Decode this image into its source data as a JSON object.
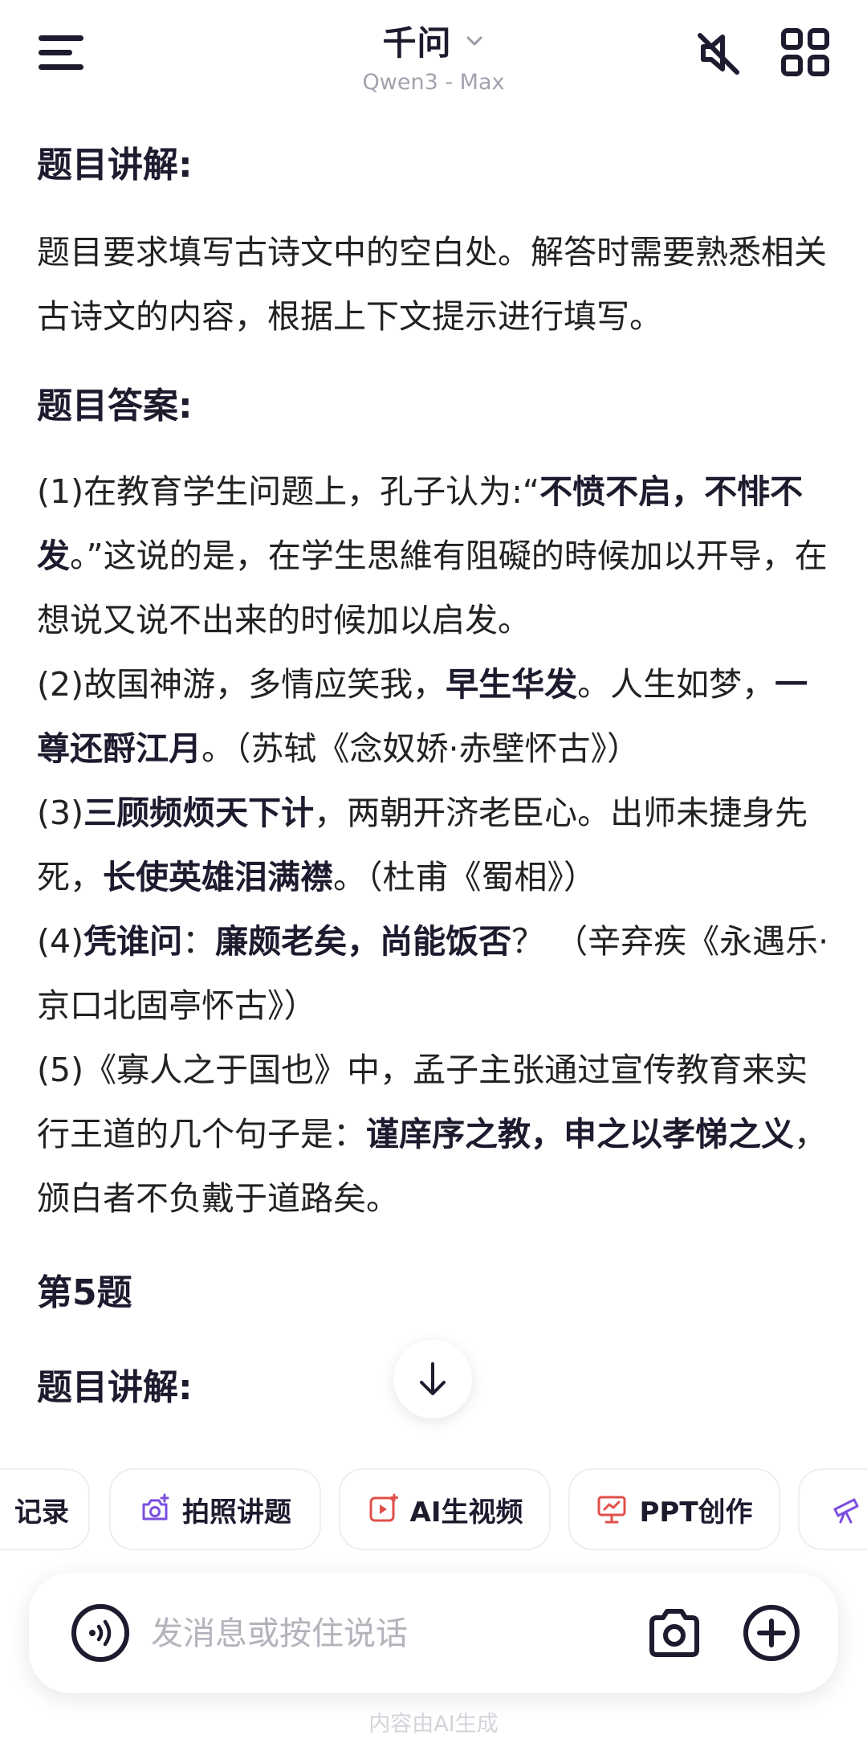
{
  "header": {
    "title": "千问",
    "model": "Qwen3 - Max",
    "icons": {
      "menu": "menu-icon",
      "dropdown": "chevron-down-icon",
      "mute": "speaker-muted-icon",
      "apps": "apps-grid-icon"
    }
  },
  "content": {
    "heading1": "题目讲解:",
    "explanation": "题目要求填写古诗文中的空白处。解答时需要熟悉相关古诗文的内容，根据上下文提示进行填写。",
    "heading2": "题目答案:",
    "answers": {
      "a1_p1": "(1)在教育学生问题上，孔子认为:“",
      "a1_b1": "不愤不启，不悱不发",
      "a1_p2": "。”这说的是，在学生思維有阻礙的時候加以开导，在想说又说不出来的时候加以启发。",
      "a2_p1": "(2)故国神游，多情应笑我，",
      "a2_b1": "早生华发",
      "a2_p2": "。人生如梦，",
      "a2_b2": "一尊还酹江月",
      "a2_p3": "。（苏轼《念奴娇·赤壁怀古》）",
      "a3_p1": "(3)",
      "a3_b1": "三顾频烦天下计",
      "a3_p2": "，两朝开济老臣心。出师未捷身先死，",
      "a3_b2": "长使英雄泪满襟",
      "a3_p3": "。（杜甫《蜀相》）",
      "a4_p1": "(4)",
      "a4_b1": "凭谁问",
      "a4_p2": "：",
      "a4_b2": "廉颇老矣，尚能饭否",
      "a4_p3": "？ （辛弃疾《永遇乐·京口北固亭怀古》）",
      "a5_p1": "(5)《寡人之于国也》中，孟子主张通过宣传教育来实行王道的几个句子是：",
      "a5_b1": "谨庠序之教，申之以孝悌之义",
      "a5_p2": "，颁白者不负戴于道路矣。"
    },
    "heading3": "第5题",
    "heading4": "题目讲解:"
  },
  "scroll_icon": "arrow-down-icon",
  "chips": [
    {
      "label": "记录",
      "icon": ""
    },
    {
      "label": "拍照讲题",
      "icon": "camera-plus-icon"
    },
    {
      "label": "AI生视频",
      "icon": "video-play-icon"
    },
    {
      "label": "PPT创作",
      "icon": "presentation-icon"
    },
    {
      "label": "",
      "icon": "telescope-icon"
    }
  ],
  "input": {
    "placeholder": "发消息或按住说话",
    "value": "",
    "icons": {
      "voice": "voice-wave-icon",
      "camera": "camera-icon",
      "plus": "plus-circle-icon"
    }
  },
  "footer": "内容由AI生成",
  "colors": {
    "text": "#1d1b2e",
    "muted": "#a3a2ad",
    "accent": "#7b4fe0",
    "accent_red": "#e0504a"
  }
}
